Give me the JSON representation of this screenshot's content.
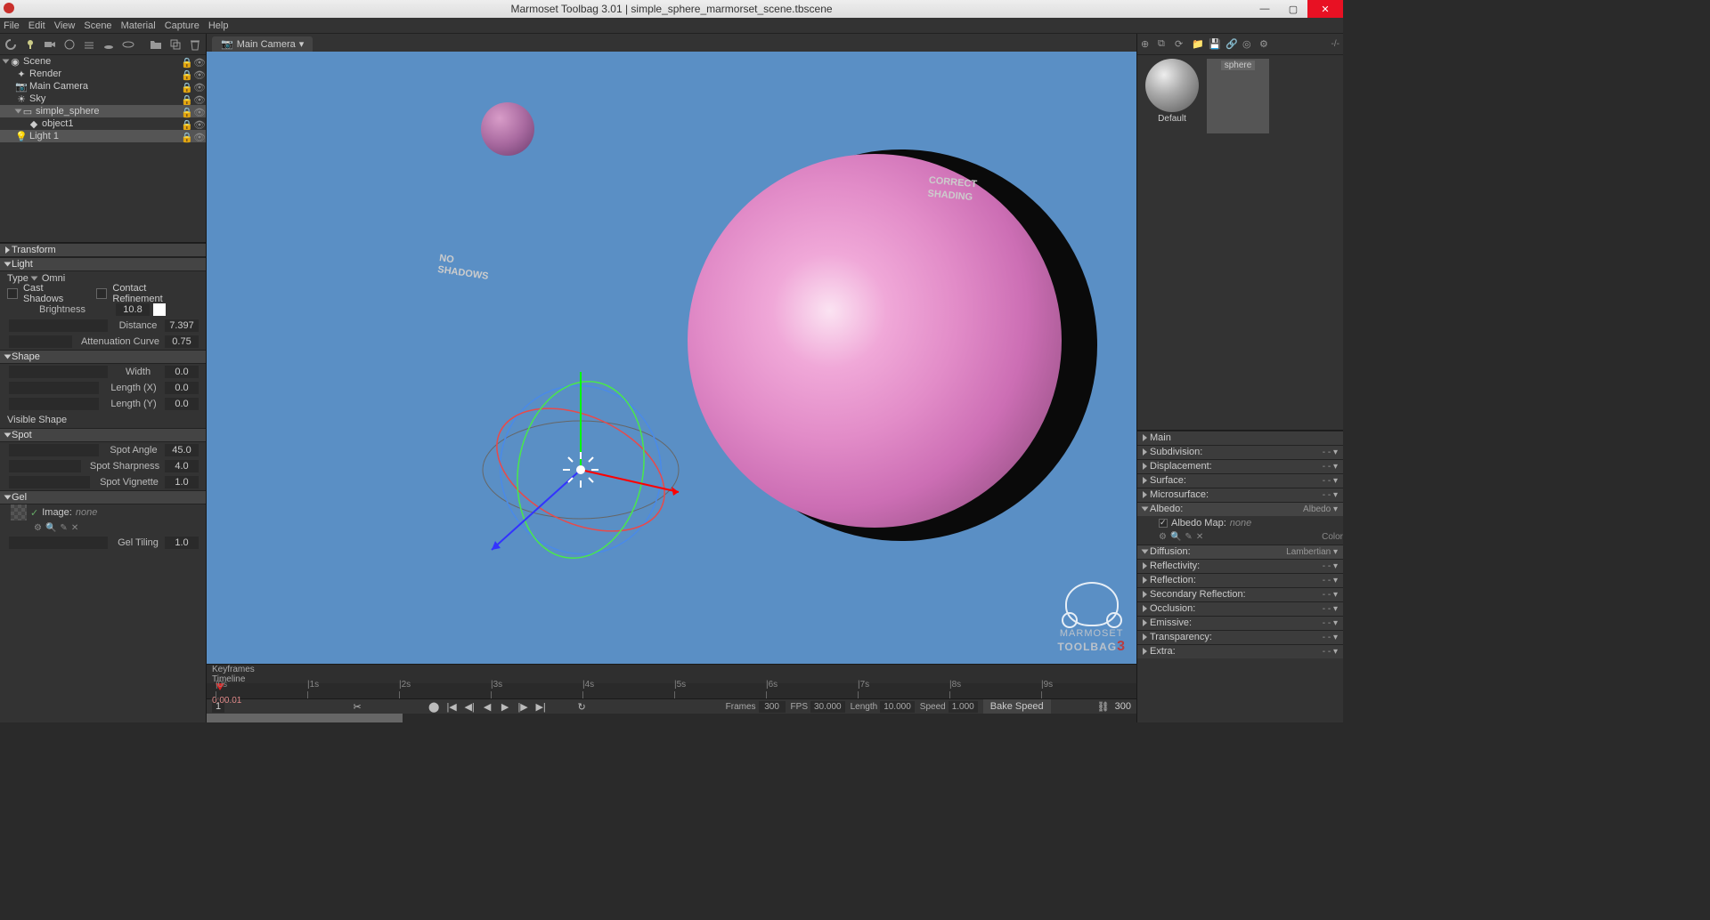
{
  "title": "Marmoset Toolbag 3.01  |  simple_sphere_marmorset_scene.tbscene",
  "menubar": [
    "File",
    "Edit",
    "View",
    "Scene",
    "Material",
    "Capture",
    "Help"
  ],
  "camera_tab": "Main Camera",
  "zoom_indicator": "-/-",
  "outliner": [
    {
      "label": "Scene",
      "indent": 0,
      "open": true,
      "icon": "scene",
      "sel": false
    },
    {
      "label": "Render",
      "indent": 1,
      "icon": "render",
      "sel": false
    },
    {
      "label": "Main Camera",
      "indent": 1,
      "icon": "camera",
      "sel": false
    },
    {
      "label": "Sky",
      "indent": 1,
      "icon": "sky",
      "sel": false
    },
    {
      "label": "simple_sphere",
      "indent": 1,
      "open": true,
      "icon": "group",
      "sel": true
    },
    {
      "label": "object1",
      "indent": 2,
      "icon": "mesh",
      "sel": false
    },
    {
      "label": "Light 1",
      "indent": 1,
      "icon": "light",
      "sel": true
    }
  ],
  "panels": {
    "transform": "Transform",
    "light": "Light",
    "type_label": "Type",
    "type_value": "Omni",
    "cast_shadows": "Cast Shadows",
    "contact_refinement": "Contact Refinement",
    "brightness_label": "Brightness",
    "brightness_val": "10.8",
    "distance_label": "Distance",
    "distance_val": "7.397",
    "atten_label": "Attenuation Curve",
    "atten_val": "0.75",
    "shape": "Shape",
    "width_label": "Width",
    "width_val": "0.0",
    "lenx_label": "Length (X)",
    "lenx_val": "0.0",
    "leny_label": "Length (Y)",
    "leny_val": "0.0",
    "visible_shape": "Visible Shape",
    "spot": "Spot",
    "spot_angle_label": "Spot Angle",
    "spot_angle_val": "45.0",
    "spot_sharp_label": "Spot Sharpness",
    "spot_sharp_val": "4.0",
    "spot_vig_label": "Spot Vignette",
    "spot_vig_val": "1.0",
    "gel": "Gel",
    "gel_image_label": "Image:",
    "gel_image_val": "none",
    "gel_tiling_label": "Gel Tiling",
    "gel_tiling_val": "1.0"
  },
  "annotations": {
    "no_shadows": "NO SHADOWS",
    "correct_shading": "CORRECT SHADING",
    "arrow_delim": "◁—"
  },
  "logo": {
    "line1": "MARMOSET",
    "line2": "TOOLBAG",
    "ver": "3"
  },
  "timeline": {
    "keyframes_label": "Keyframes",
    "timeline_label": "Timeline",
    "ticks": [
      "|0s",
      "|1s",
      "|2s",
      "|3s",
      "|4s",
      "|5s",
      "|6s",
      "|7s",
      "|8s",
      "|9s"
    ],
    "time": "0:00.01",
    "frames_label": "Frames",
    "frames": "300",
    "fps_label": "FPS",
    "fps": "30.000",
    "length_label": "Length",
    "length": "10.000",
    "speed_label": "Speed",
    "speed": "1.000",
    "bake_speed": "Bake Speed",
    "link_icon": "⛓",
    "end_frame": "300",
    "start_frame": "1"
  },
  "materials": {
    "default": "Default",
    "sphere": "sphere"
  },
  "rpanels": {
    "main": "Main",
    "subdivision": "Subdivision:",
    "displacement": "Displacement:",
    "surface": "Surface:",
    "microsurface": "Microsurface:",
    "albedo": "Albedo:",
    "albedo_mode": "Albedo",
    "albedo_map": "Albedo Map:",
    "albedo_map_val": "none",
    "color_label": "Color",
    "diffusion": "Diffusion:",
    "diffusion_mode": "Lambertian",
    "reflectivity": "Reflectivity:",
    "reflection": "Reflection:",
    "secondary_reflection": "Secondary Reflection:",
    "occlusion": "Occlusion:",
    "emissive": "Emissive:",
    "transparency": "Transparency:",
    "extra": "Extra:",
    "dash": "- -"
  },
  "window_btn": {
    "min": "—",
    "max": "▢",
    "close": "✕"
  }
}
